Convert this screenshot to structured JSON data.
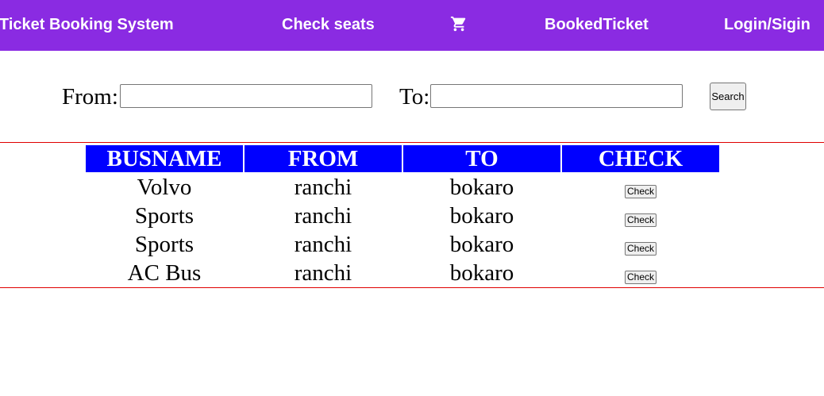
{
  "nav": {
    "brand": "Ticket Booking System",
    "check_seats": "Check seats",
    "cart_icon": "shopping-cart-icon",
    "booked_ticket": "BookedTicket",
    "login": "Login/Sigin"
  },
  "search": {
    "from_label": "From:",
    "from_value": "",
    "to_label": "To:",
    "to_value": "",
    "button_label": "Search"
  },
  "table": {
    "headers": [
      "BUSNAME",
      "FROM",
      "TO",
      "CHECK"
    ],
    "rows": [
      {
        "busname": "Volvo",
        "from": "ranchi",
        "to": "bokaro",
        "action": "Check"
      },
      {
        "busname": "Sports",
        "from": "ranchi",
        "to": "bokaro",
        "action": "Check"
      },
      {
        "busname": "Sports",
        "from": "ranchi",
        "to": "bokaro",
        "action": "Check"
      },
      {
        "busname": "AC Bus",
        "from": "ranchi",
        "to": "bokaro",
        "action": "Check"
      }
    ]
  },
  "colors": {
    "navbar": "#8a2be2",
    "table_header": "#0000ff",
    "divider": "#e00000"
  }
}
